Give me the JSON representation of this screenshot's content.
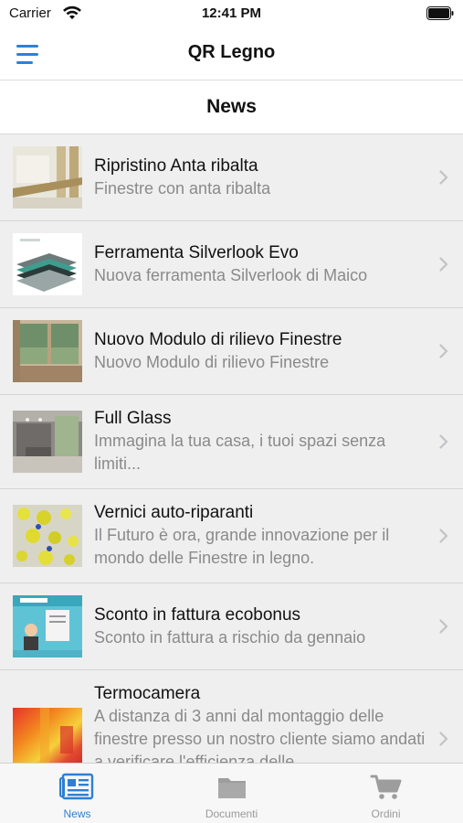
{
  "status_bar": {
    "carrier": "Carrier",
    "time": "12:41 PM"
  },
  "nav_bar": {
    "title": "QR Legno",
    "menu_icon": "hamburger-menu-icon"
  },
  "section": {
    "title": "News"
  },
  "news": [
    {
      "title": "Ripristino  Anta ribalta",
      "subtitle": "Finestre con anta ribalta",
      "height": 0
    },
    {
      "title": "Ferramenta Silverlook Evo",
      "subtitle": "Nuova ferramenta Silverlook di Maico"
    },
    {
      "title": "Nuovo Modulo di rilievo Finestre",
      "subtitle": "Nuovo Modulo di rilievo Finestre"
    },
    {
      "title": "Full Glass",
      "subtitle": "Immagina la tua casa, i tuoi spazi senza limiti..."
    },
    {
      "title": "Vernici auto-riparanti",
      "subtitle": "Il Futuro è ora, grande innovazione per il mondo delle Finestre in legno."
    },
    {
      "title": "Sconto in fattura ecobonus",
      "subtitle": "Sconto in fattura a rischio da gennaio"
    },
    {
      "title": "Termocamera",
      "subtitle": "A distanza di 3 anni dal montaggio delle finestre presso un nostro cliente siamo andati a verificare l'efficienza delle"
    }
  ],
  "tabs": [
    {
      "label": "News",
      "icon": "newspaper-icon",
      "active": true
    },
    {
      "label": "Documenti",
      "icon": "folder-icon",
      "active": false
    },
    {
      "label": "Ordini",
      "icon": "cart-icon",
      "active": false
    }
  ],
  "colors": {
    "accent": "#2f80d6",
    "list_background": "#efefef",
    "subtitle_text": "#8a8a8a"
  }
}
